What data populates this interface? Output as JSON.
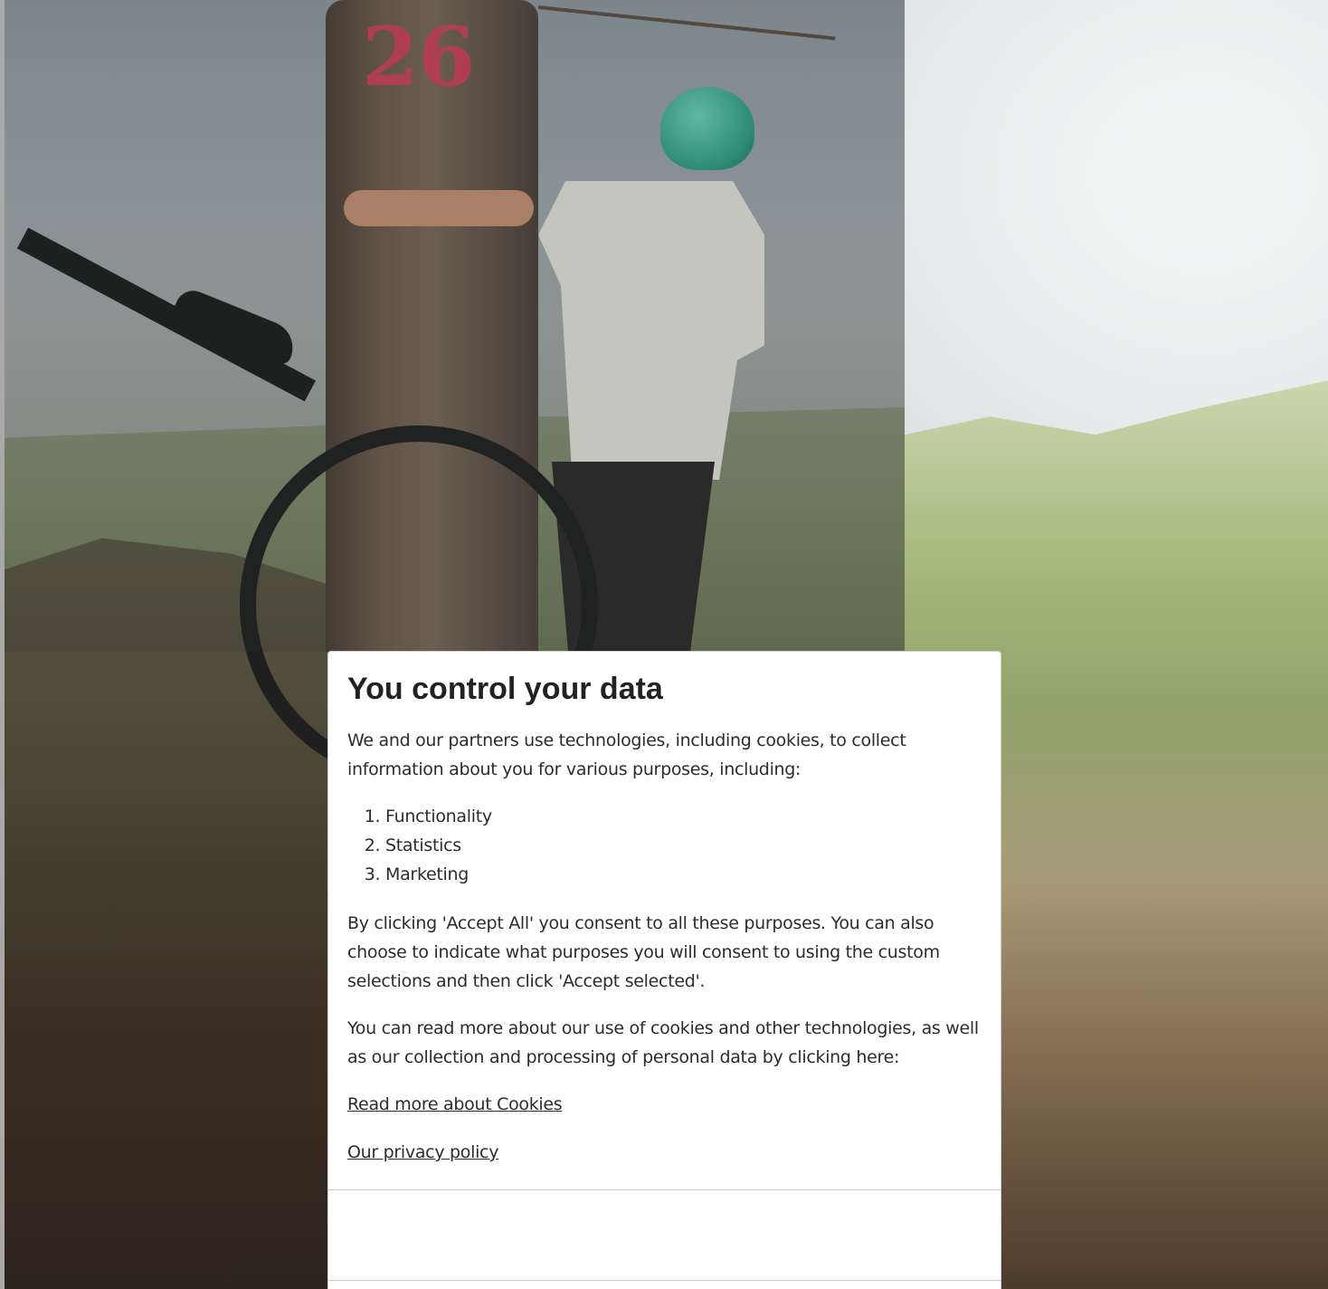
{
  "dialog": {
    "title": "You control your data",
    "intro": "We and our partners use technologies, including cookies, to collect information about you for various purposes, including:",
    "purposes": [
      "Functionality",
      "Statistics",
      "Marketing"
    ],
    "consent_text": "By clicking 'Accept All' you consent to all these purposes. You can also choose to indicate what purposes you will consent to using the custom selections and then click 'Accept selected'.",
    "read_more_text": "You can read more about our use of cookies and other technologies, as well as our collection and processing of personal data by clicking here:",
    "links": {
      "cookies": "Read more about Cookies",
      "privacy": "Our privacy policy"
    }
  },
  "background": {
    "tree_marking": "26"
  }
}
